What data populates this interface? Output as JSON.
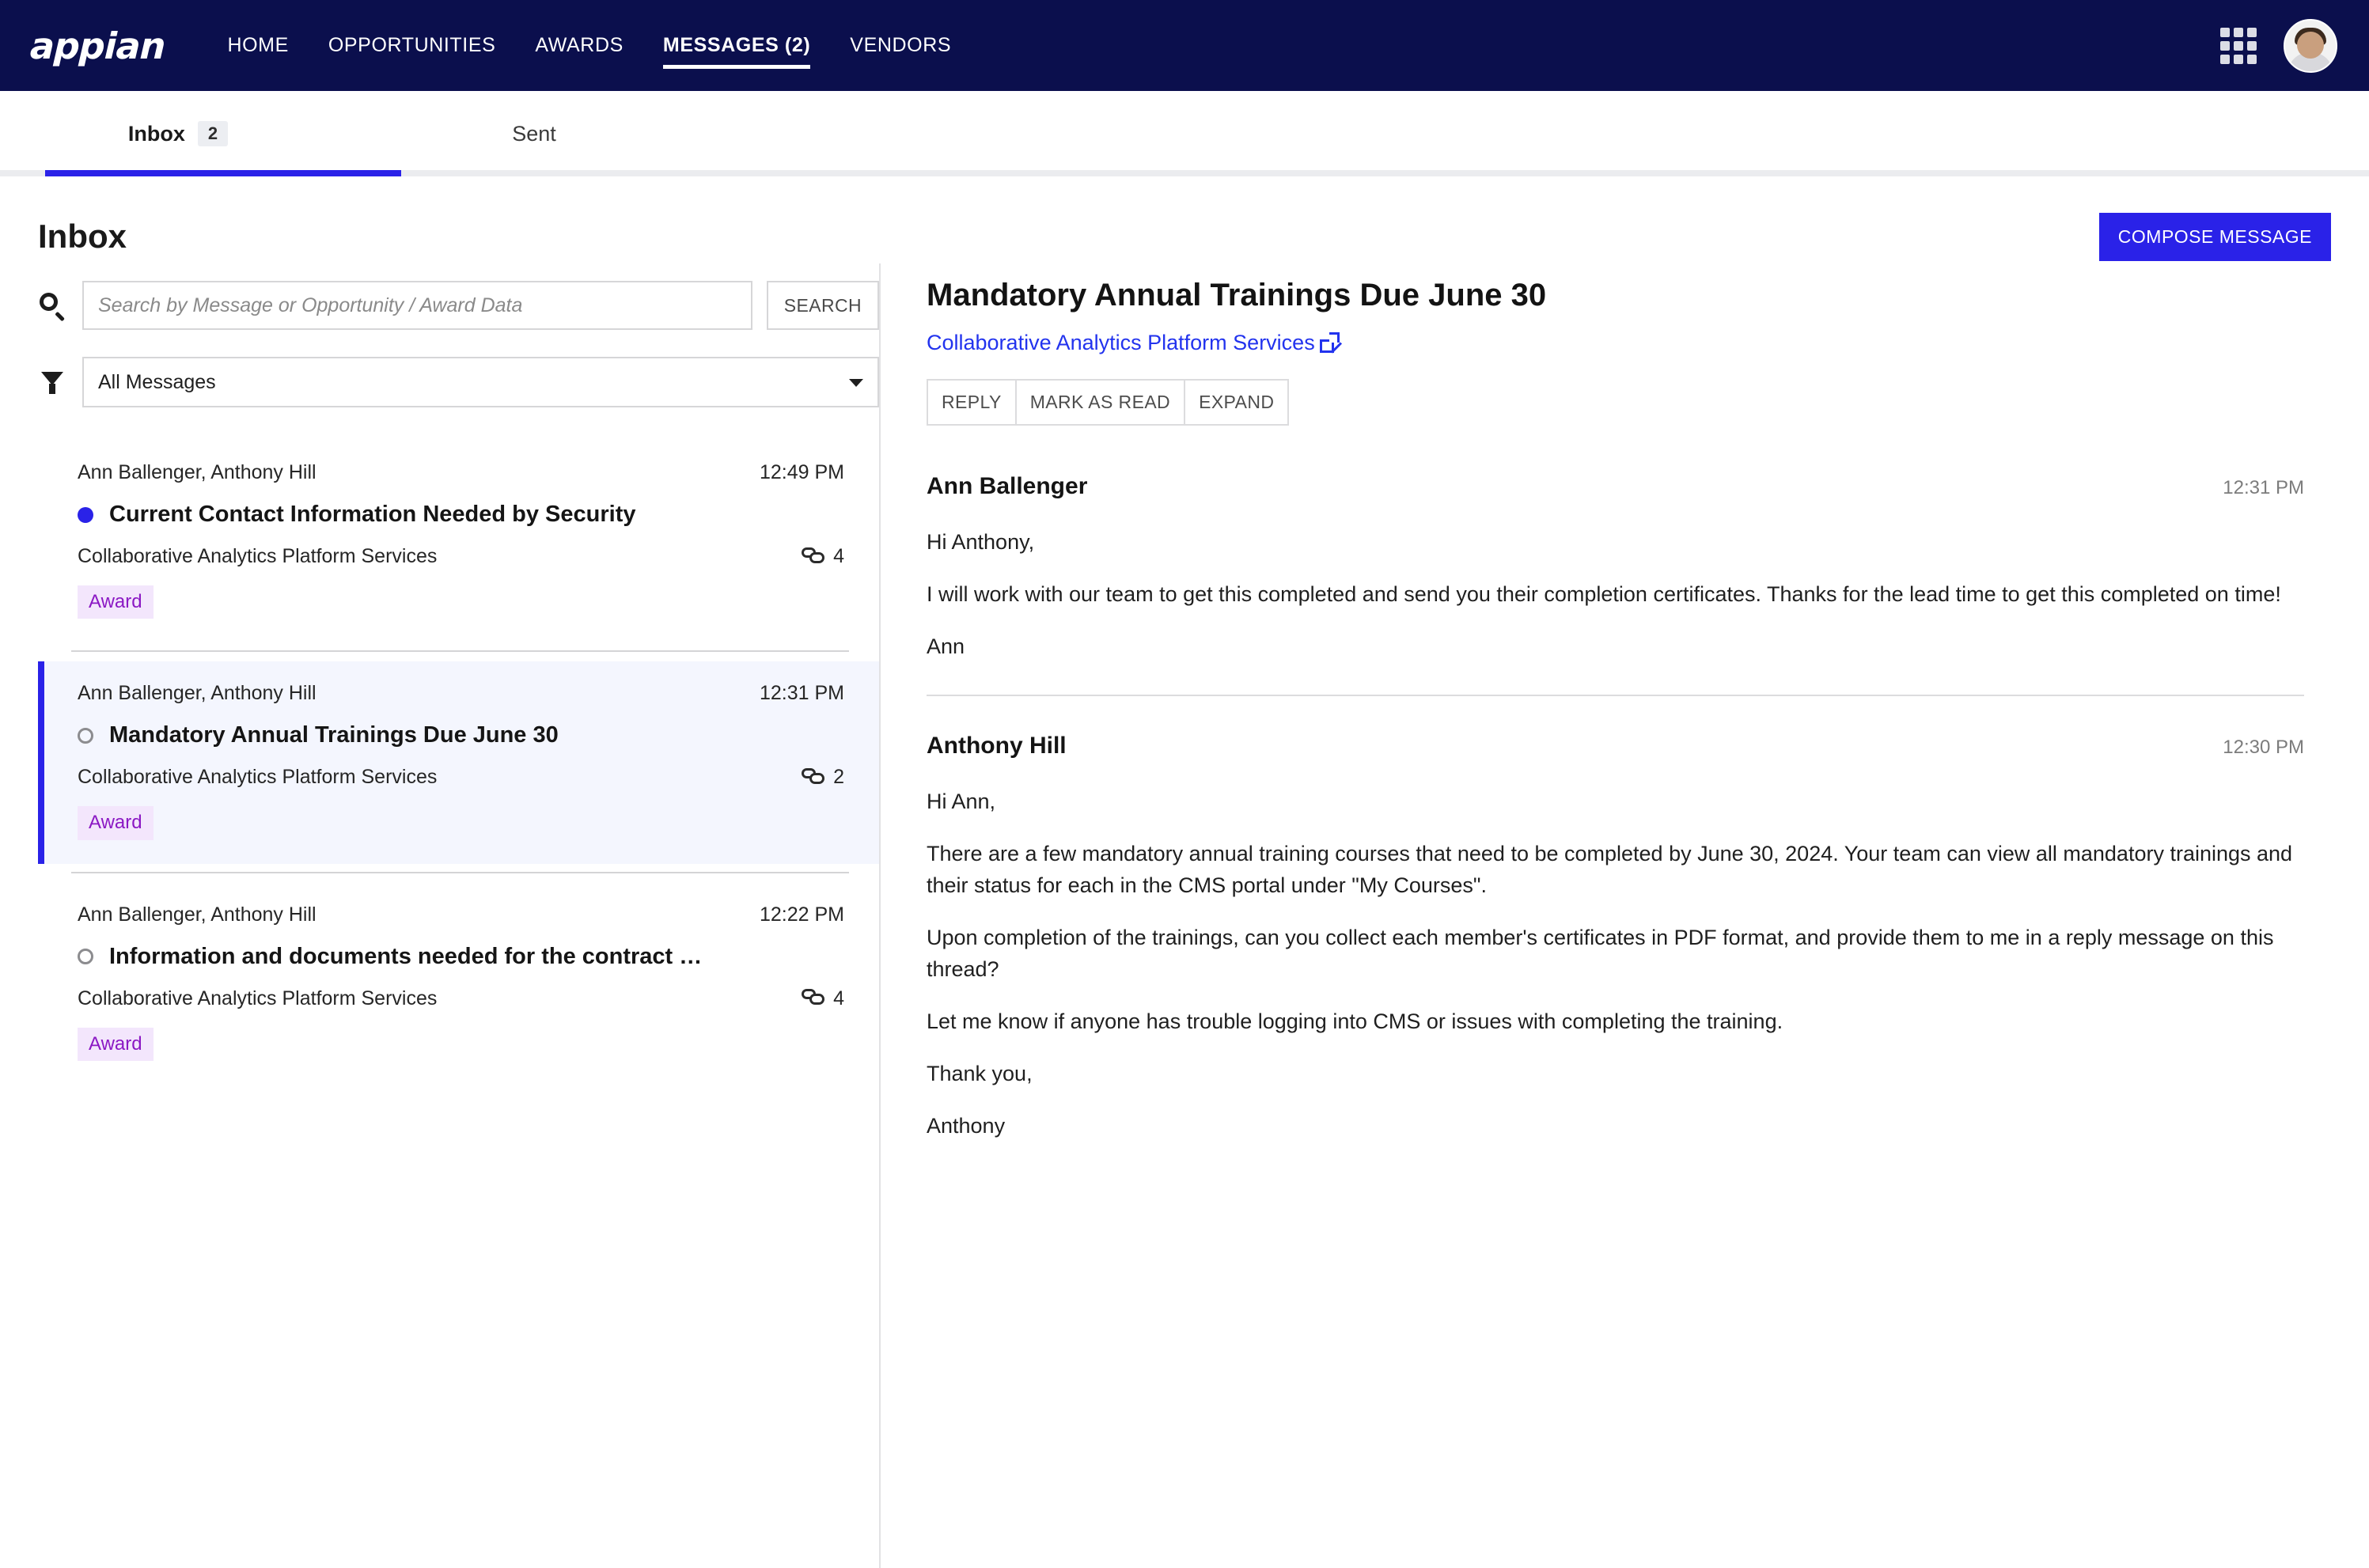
{
  "topnav": {
    "brand": "appian",
    "links": [
      {
        "label": "HOME",
        "active": false
      },
      {
        "label": "OPPORTUNITIES",
        "active": false
      },
      {
        "label": "AWARDS",
        "active": false
      },
      {
        "label": "MESSAGES (2)",
        "active": true
      },
      {
        "label": "VENDORS",
        "active": false
      }
    ],
    "apps_icon": "grid-icon",
    "avatar_icon": "user-avatar"
  },
  "tabs": [
    {
      "label": "Inbox",
      "badge": "2",
      "active": true
    },
    {
      "label": "Sent",
      "badge": "",
      "active": false
    }
  ],
  "header": {
    "title": "Inbox",
    "compose_label": "COMPOSE MESSAGE"
  },
  "search": {
    "placeholder": "Search by Message or Opportunity / Award Data",
    "value": "",
    "button_label": "SEARCH"
  },
  "filter": {
    "selected": "All Messages",
    "options": [
      "All Messages"
    ]
  },
  "messages": [
    {
      "people": "Ann Ballenger, Anthony Hill",
      "time": "12:49 PM",
      "subject": "Current Contact Information Needed by Security",
      "opportunity": "Collaborative Analytics Platform Services",
      "reply_count": "4",
      "tag": "Award",
      "unread": true,
      "selected": false
    },
    {
      "people": "Ann Ballenger, Anthony Hill",
      "time": "12:31 PM",
      "subject": "Mandatory Annual Trainings Due June 30",
      "opportunity": "Collaborative Analytics Platform Services",
      "reply_count": "2",
      "tag": "Award",
      "unread": false,
      "selected": true
    },
    {
      "people": "Ann Ballenger, Anthony Hill",
      "time": "12:22 PM",
      "subject": "Information and documents needed for the contract …",
      "opportunity": "Collaborative Analytics Platform Services",
      "reply_count": "4",
      "tag": "Award",
      "unread": false,
      "selected": false
    }
  ],
  "thread": {
    "title": "Mandatory Annual Trainings Due June 30",
    "link_label": "Collaborative Analytics Platform Services",
    "actions": [
      {
        "label": "REPLY"
      },
      {
        "label": "MARK AS READ"
      },
      {
        "label": "EXPAND"
      }
    ],
    "messages": [
      {
        "author": "Ann Ballenger",
        "time": "12:31 PM",
        "paragraphs": [
          "Hi Anthony,",
          "I will work with our team to get this completed and send you their completion certificates. Thanks for the lead time to get this completed on time!",
          "Ann"
        ]
      },
      {
        "author": "Anthony Hill",
        "time": "12:30 PM",
        "paragraphs": [
          "Hi Ann,",
          "There are a few mandatory annual training courses that need to be completed by June 30, 2024. Your team can view all mandatory trainings and their status for each in the CMS portal under \"My Courses\".",
          "Upon completion of the trainings, can you collect each member's certificates in PDF format, and provide them to me in a reply message on this thread?",
          "Let me know if anyone has trouble logging into CMS or issues with completing the training.",
          "Thank you,",
          "Anthony"
        ]
      }
    ]
  },
  "colors": {
    "nav_background": "#0B0F4D",
    "accent": "#2A22E8",
    "tag_text": "#8B18C4",
    "tag_background": "#F3E6FC",
    "link": "#2233EE",
    "selected_row_background": "#F4F6FE"
  }
}
